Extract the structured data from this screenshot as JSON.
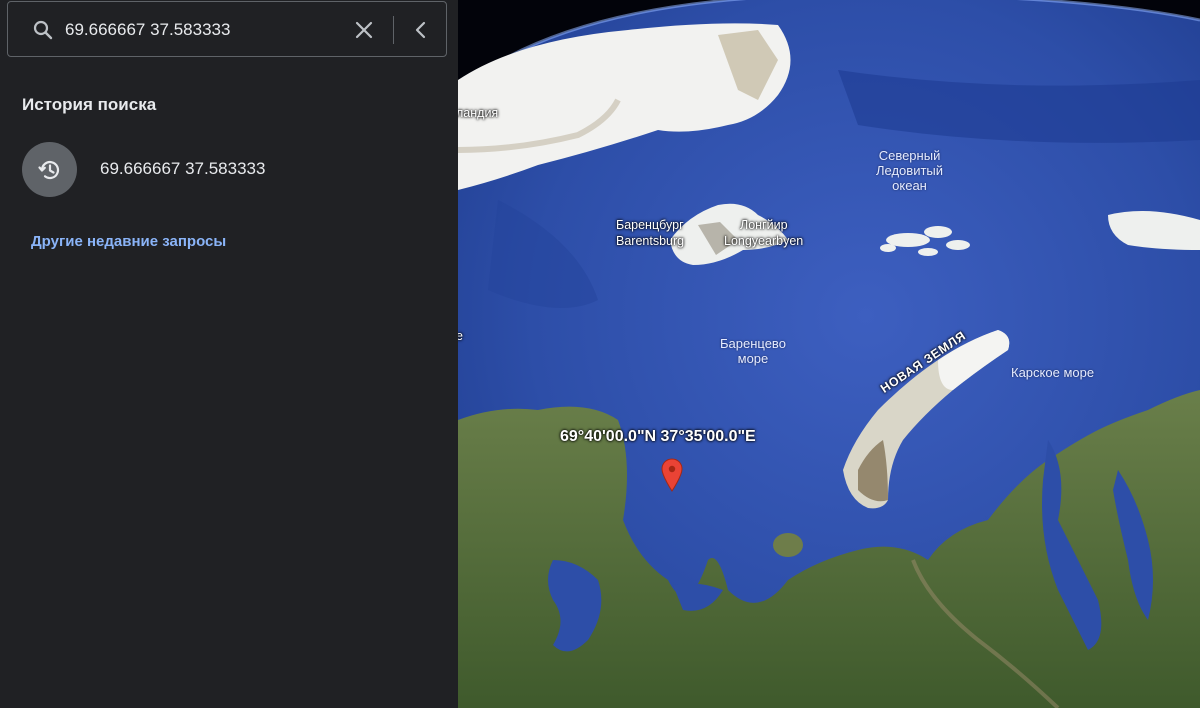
{
  "search": {
    "query": "69.666667 37.583333",
    "icon": "search-icon",
    "clear_icon": "close-icon",
    "collapse_icon": "chevron-left-icon"
  },
  "history": {
    "heading": "История поиска",
    "items": [
      {
        "text": "69.666667 37.583333",
        "icon": "history-icon"
      }
    ],
    "more_link": "Другие недавние запросы"
  },
  "map": {
    "labels": {
      "greenland_partial": "ландия",
      "arctic_ocean": "Северный\nЛедовитый\nокеан",
      "barentsburg_ru": "Баренцбург",
      "barentsburg_en": "Barentsburg",
      "longyearbyen_ru": "Лонгйир",
      "longyearbyen_en": "Longyearbyen",
      "barents_sea": "Баренцево\nморе",
      "kara_sea": "Карское море",
      "novaya_zemlya": "НОВАЯ ЗЕМЛЯ",
      "edge_partial": "е",
      "marker_coordinates": "69°40'00.0\"N 37°35'00.0\"E"
    },
    "marker_icon": "map-pin-icon",
    "colors": {
      "pin": "#ea4335",
      "link": "#8ab4f8",
      "sidebar": "#202124"
    }
  }
}
